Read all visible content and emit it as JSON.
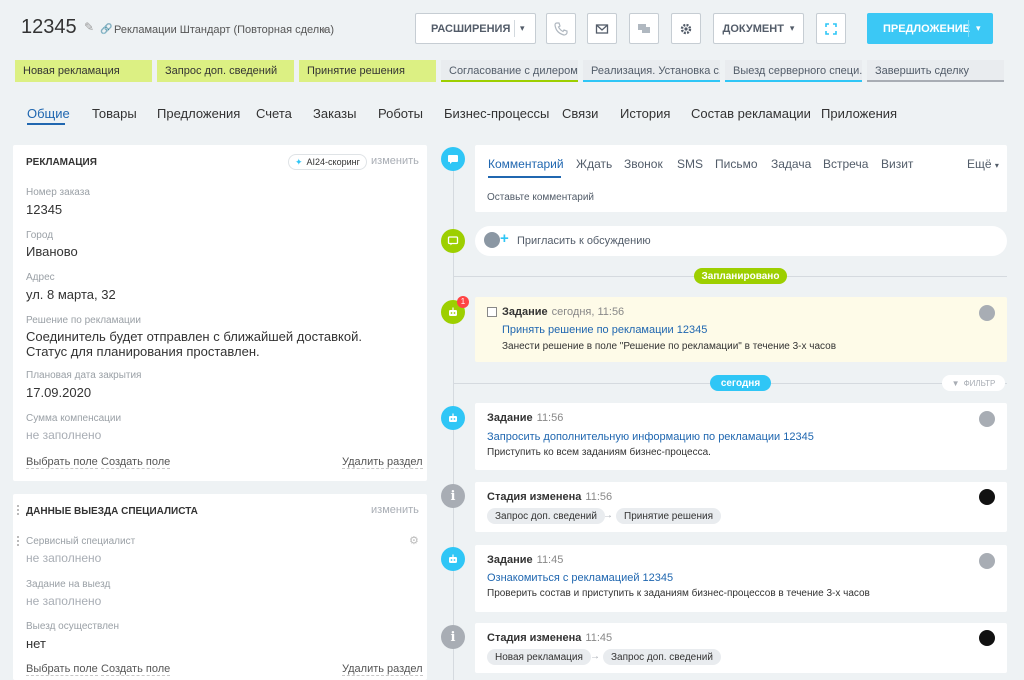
{
  "header": {
    "deal_id": "12345",
    "pipeline": "Рекламации Штандарт (Повторная сделка)",
    "extensions_label": "РАСШИРЕНИЯ",
    "document_label": "ДОКУМЕНТ",
    "offer_label": "ПРЕДЛОЖЕНИЕ"
  },
  "stages": [
    {
      "label": "Новая рекламация"
    },
    {
      "label": "Запрос доп. сведений"
    },
    {
      "label": "Принятие решения"
    },
    {
      "label": "Согласование с дилером"
    },
    {
      "label": "Реализация. Установка с..."
    },
    {
      "label": "Выезд серверного специ..."
    },
    {
      "label": "Завершить сделку"
    }
  ],
  "tabs": [
    "Общие",
    "Товары",
    "Предложения",
    "Счета",
    "Заказы",
    "Роботы",
    "Бизнес-процессы",
    "Связи",
    "История",
    "Состав рекламации",
    "Приложения"
  ],
  "complaint_card": {
    "title": "РЕКЛАМАЦИЯ",
    "ai_chip": "AI24-скоринг",
    "change": "изменить",
    "fields": [
      {
        "label": "Номер заказа",
        "value": "12345"
      },
      {
        "label": "Город",
        "value": "Иваново"
      },
      {
        "label": "Адрес",
        "value": "ул. 8 марта, 32"
      },
      {
        "label": "Решение по рекламации",
        "value": "Соединитель будет отправлен с ближайшей доставкой. Статус для планирования проставлен."
      },
      {
        "label": "Плановая дата закрытия",
        "value": "17.09.2020"
      },
      {
        "label": "Сумма компенсации",
        "value": "не заполнено"
      }
    ],
    "select_field": "Выбрать поле",
    "create_field": "Создать поле",
    "delete_section": "Удалить раздел"
  },
  "visit_card": {
    "title": "ДАННЫЕ ВЫЕЗДА СПЕЦИАЛИСТА",
    "change": "изменить",
    "fields": [
      {
        "label": "Сервисный специалист",
        "value": "не заполнено"
      },
      {
        "label": "Задание на выезд",
        "value": "не заполнено"
      },
      {
        "label": "Выезд осуществлен",
        "value": "нет"
      }
    ],
    "select_field": "Выбрать поле",
    "create_field": "Создать поле",
    "delete_section": "Удалить раздел"
  },
  "editor": {
    "tabs": [
      "Комментарий",
      "Ждать",
      "Звонок",
      "SMS",
      "Письмо",
      "Задача",
      "Встреча",
      "Визит",
      "Ещё"
    ],
    "placeholder": "Оставьте комментарий"
  },
  "invite": "Пригласить к обсуждению",
  "planned_label": "Запланировано",
  "today_label": "сегодня",
  "filter_label": "ФИЛЬТР",
  "badge_count": "1",
  "timeline": [
    {
      "head": "Задание",
      "time": "сегодня, 11:56",
      "link": "Принять решение по рекламации 12345",
      "desc": "Занести решение в поле \"Решение по рекламации\" в течение 3-х часов"
    },
    {
      "head": "Задание",
      "time": "11:56",
      "link": "Запросить дополнительную информацию по рекламации 12345",
      "desc": "Приступить ко всем заданиям бизнес-процесса."
    },
    {
      "head": "Стадия изменена",
      "time": "11:56",
      "from": "Запрос доп. сведений",
      "to": "Принятие решения"
    },
    {
      "head": "Задание",
      "time": "11:45",
      "link": "Ознакомиться с рекламацией 12345",
      "desc": "Проверить состав и приступить к заданиям бизнес-процессов в течение 3-х часов"
    },
    {
      "head": "Стадия изменена",
      "time": "11:45",
      "from": "Новая рекламация",
      "to": "Запрос доп. сведений"
    }
  ],
  "colors": {
    "accent": "#2067b0",
    "primary_button": "#3bc8f5",
    "stage_done": "#dcf083",
    "planned": "#9dcf00",
    "today": "#2fc6f6"
  }
}
